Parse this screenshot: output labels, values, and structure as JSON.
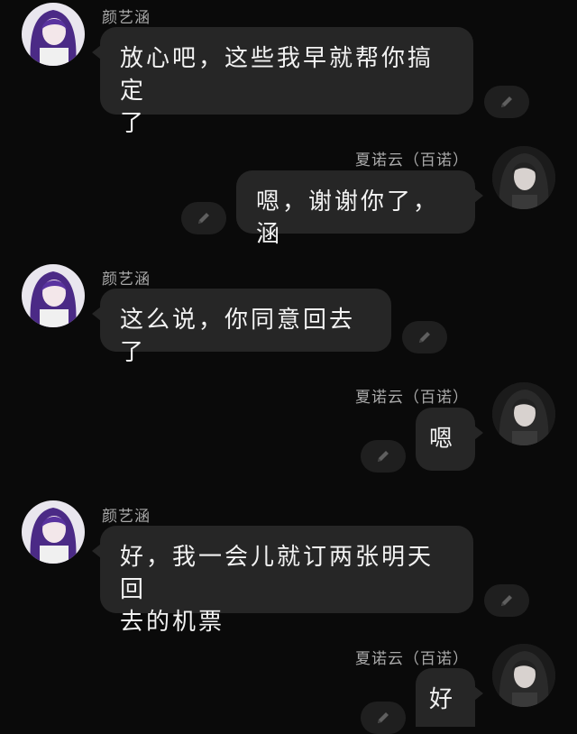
{
  "messages": [
    {
      "side": "left",
      "sender": "颜艺涵",
      "lines": [
        "放心吧，这些我早就帮你搞定",
        "了"
      ]
    },
    {
      "side": "right",
      "sender": "夏诺云（百诺）",
      "lines": [
        "嗯，谢谢你了，涵"
      ]
    },
    {
      "side": "left",
      "sender": "颜艺涵",
      "lines": [
        "这么说，你同意回去了"
      ]
    },
    {
      "side": "right",
      "sender": "夏诺云（百诺）",
      "lines": [
        "嗯"
      ]
    },
    {
      "side": "left",
      "sender": "颜艺涵",
      "lines": [
        "好，我一会儿就订两张明天回",
        "去的机票"
      ]
    },
    {
      "side": "right",
      "sender": "夏诺云（百诺）",
      "lines": [
        "好"
      ]
    }
  ],
  "colors": {
    "background": "#0a0a0a",
    "bubble": "#262626",
    "name": "#a9a9a9",
    "text": "#f2f2f2",
    "edit_button": "#1f1f1f"
  },
  "icons": {
    "edit": "pencil-icon",
    "avatar_left": "purple-hair-girl-avatar",
    "avatar_right": "dark-hair-girl-avatar"
  }
}
